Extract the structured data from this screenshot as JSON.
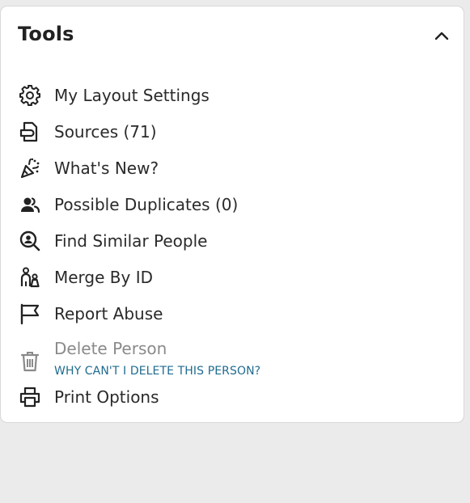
{
  "tools": {
    "title": "Tools",
    "items": [
      {
        "label": "My Layout Settings",
        "icon": "gear-icon"
      },
      {
        "label": "Sources (71)",
        "icon": "sources-icon"
      },
      {
        "label": "What's New?",
        "icon": "party-popper-icon"
      },
      {
        "label": "Possible Duplicates (0)",
        "icon": "people-icon"
      },
      {
        "label": "Find Similar People",
        "icon": "search-person-icon"
      },
      {
        "label": "Merge By ID",
        "icon": "merge-people-icon"
      },
      {
        "label": "Report Abuse",
        "icon": "flag-icon"
      },
      {
        "label": "Delete Person",
        "icon": "trash-icon",
        "disabled": true
      },
      {
        "label": "Print Options",
        "icon": "printer-icon"
      }
    ],
    "delete_help_link": "WHY CAN'T I DELETE THIS PERSON?"
  },
  "colors": {
    "background": "#ebebeb",
    "panel": "#ffffff",
    "link": "#1f6b8f",
    "disabled_text": "#8a8a8a"
  }
}
